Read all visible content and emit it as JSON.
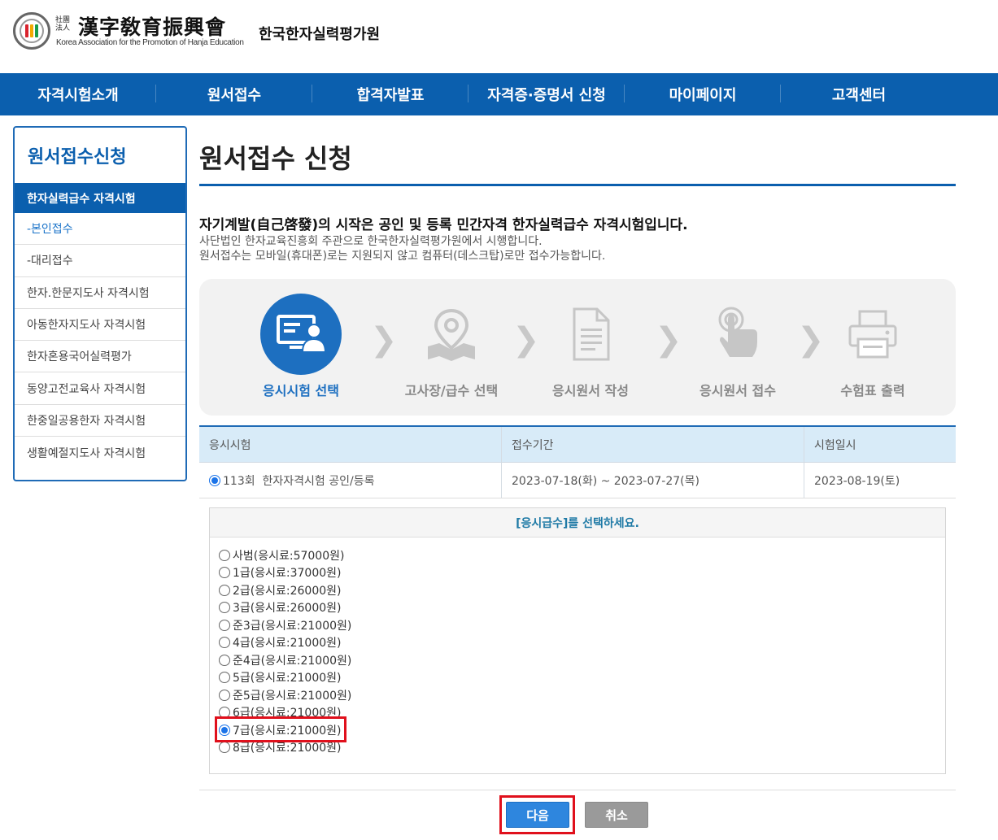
{
  "header": {
    "logo_small": "社團法人",
    "logo_hanja": "漢字敎育振興會",
    "logo_english": "Korea Association for the Promotion of Hanja Education",
    "logo_korean": "한국한자실력평가원"
  },
  "topnav": {
    "items": [
      "자격시험소개",
      "원서접수",
      "합격자발표",
      "자격증·증명서 신청",
      "마이페이지",
      "고객센터"
    ]
  },
  "sidebar": {
    "title": "원서접수신청",
    "active_group": "한자실력급수 자격시험",
    "items": [
      "-본인접수",
      "-대리접수",
      "한자.한문지도사 자격시험",
      "아동한자지도사 자격시험",
      "한자혼용국어실력평가",
      "동양고전교육사 자격시험",
      "한중일공용한자 자격시험",
      "생활예절지도사 자격시험"
    ],
    "current_index": 0
  },
  "main": {
    "page_title": "원서접수 신청",
    "intro_main": "자기계발(自己啓發)의 시작은 공인 및 등록 민간자격 한자실력급수 자격시험입니다.",
    "intro_sub1": "사단법인 한자교육진흥회 주관으로 한국한자실력평가원에서 시행합니다.",
    "intro_sub2": "원서접수는 모바일(휴대폰)로는 지원되지 않고 컴퓨터(데스크탑)로만 접수가능합니다."
  },
  "steps": [
    {
      "label": "응시시험 선택",
      "icon": "monitor-user-icon",
      "active": true
    },
    {
      "label": "고사장/급수 선택",
      "icon": "map-pin-icon",
      "active": false
    },
    {
      "label": "응시원서 작성",
      "icon": "document-icon",
      "active": false
    },
    {
      "label": "응시원서 접수",
      "icon": "touch-hand-icon",
      "active": false
    },
    {
      "label": "수험표 출력",
      "icon": "printer-icon",
      "active": false
    }
  ],
  "exam_table": {
    "headers": [
      "응시시험",
      "접수기간",
      "시험일시"
    ],
    "row": {
      "exam": "113회  한자자격시험 공인/등록",
      "period": "2023-07-18(화) ~ 2023-07-27(목)",
      "date": "2023-08-19(토)",
      "selected": true
    }
  },
  "grade_select": {
    "title": "[응시급수]를 선택하세요.",
    "options": [
      "사범(응시료:57000원)",
      "1급(응시료:37000원)",
      "2급(응시료:26000원)",
      "3급(응시료:26000원)",
      "준3급(응시료:21000원)",
      "4급(응시료:21000원)",
      "준4급(응시료:21000원)",
      "5급(응시료:21000원)",
      "준5급(응시료:21000원)",
      "6급(응시료:21000원)",
      "7급(응시료:21000원)",
      "8급(응시료:21000원)"
    ],
    "selected_index": 10
  },
  "buttons": {
    "next": "다음",
    "cancel": "취소"
  },
  "colors": {
    "primary": "#0b5fae",
    "highlight": "#e0101c",
    "table_header": "#d8ebf8"
  }
}
